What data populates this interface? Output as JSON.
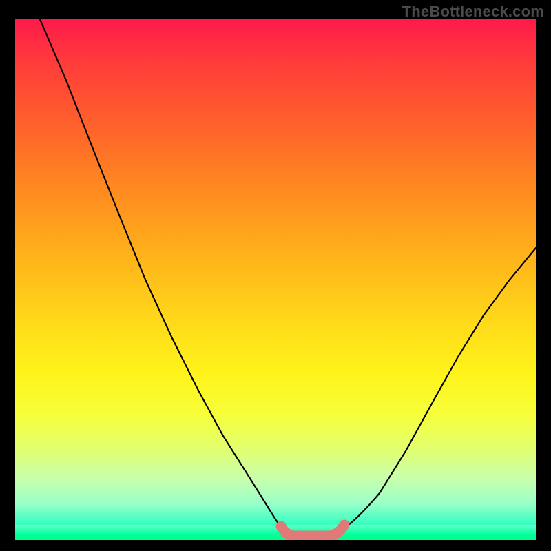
{
  "watermark": "TheBottleneck.com",
  "chart_data": {
    "type": "line",
    "title": "",
    "xlabel": "",
    "ylabel": "",
    "xlim": [
      0,
      100
    ],
    "ylim": [
      0,
      100
    ],
    "series": [
      {
        "name": "bottleneck-curve",
        "x": [
          5,
          10,
          15,
          20,
          25,
          30,
          35,
          40,
          45,
          50,
          52,
          54,
          58,
          60,
          62,
          65,
          70,
          75,
          80,
          85,
          90,
          95,
          100
        ],
        "y": [
          100,
          88,
          75,
          62,
          50,
          39,
          29,
          20,
          12,
          4,
          1,
          0,
          0,
          0,
          1,
          3,
          9,
          17,
          26,
          35,
          43,
          50,
          56
        ]
      },
      {
        "name": "highlight-band",
        "x": [
          51,
          63
        ],
        "y": [
          0,
          0
        ]
      }
    ],
    "colors": {
      "curve": "#000000",
      "highlight": "#e07a78",
      "gradient_top": "#ff1a4b",
      "gradient_bottom": "#00ff96"
    }
  }
}
